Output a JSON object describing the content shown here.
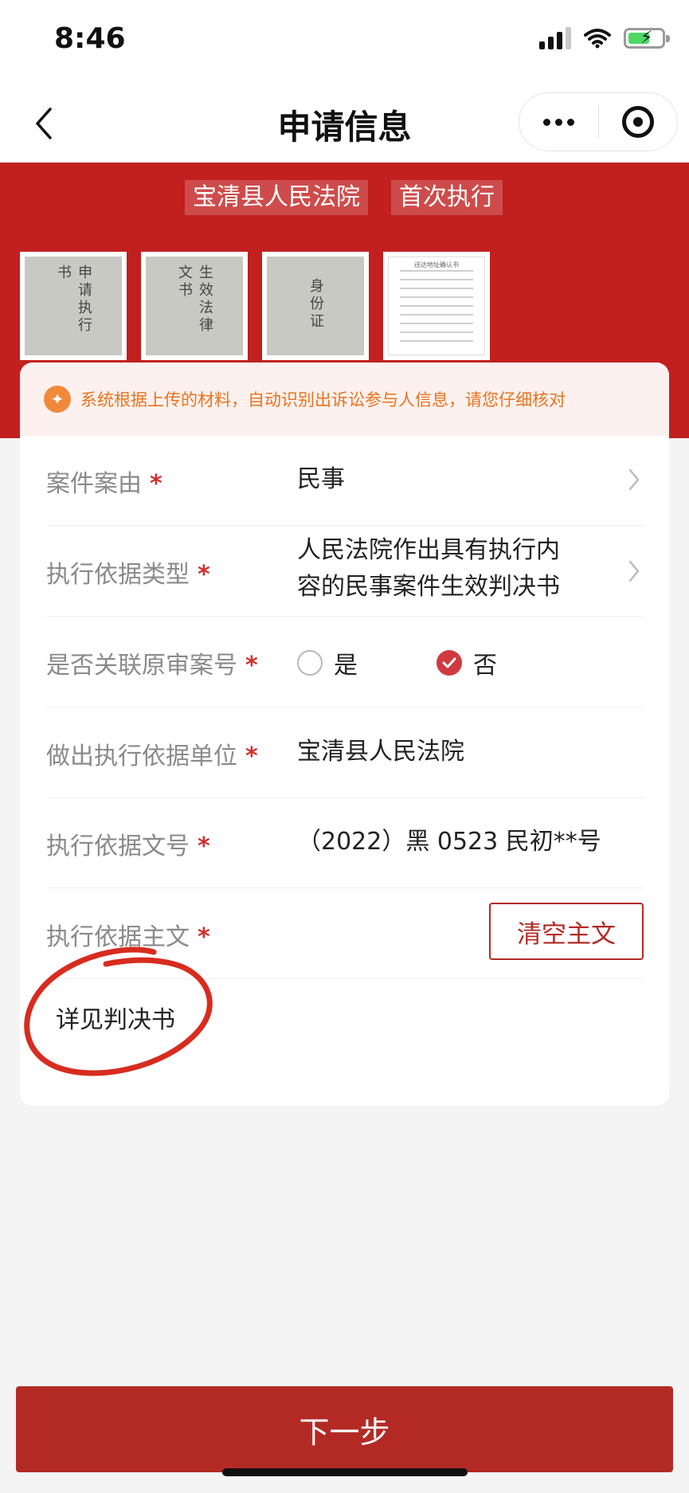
{
  "status_bar": {
    "time": "8:46"
  },
  "nav": {
    "title": "申请信息"
  },
  "hero": {
    "court_tag": "宝清县人民法院",
    "type_tag": "首次执行",
    "thumbnails": [
      {
        "text": "申请执行书"
      },
      {
        "text": "生效法律文书"
      },
      {
        "text": "身份证"
      },
      {
        "text": "送达地址确认书"
      }
    ]
  },
  "notice": {
    "text": "系统根据上传的材料，自动识别出诉讼参与人信息，请您仔细核对"
  },
  "form": {
    "cause": {
      "label": "案件案由",
      "value": "民事"
    },
    "basis_type": {
      "label": "执行依据类型",
      "value_line1": "人民法院作出具有执行内",
      "value_line2": "容的民事案件生效判决书"
    },
    "related": {
      "label": "是否关联原审案号",
      "option_yes": "是",
      "option_no": "否",
      "selected": "否"
    },
    "unit": {
      "label": "做出执行依据单位",
      "value": "宝清县人民法院"
    },
    "doc_no": {
      "label": "执行依据文号",
      "value": "（2022）黑 0523 民初**号"
    },
    "main_text": {
      "label": "执行依据主文",
      "clear_label": "清空主文",
      "value": "详见判决书"
    },
    "required_mark": "*"
  },
  "footer": {
    "next_label": "下一步"
  },
  "colors": {
    "brand_red": "#c1201f",
    "button_red": "#b32a25",
    "notice_orange": "#e8741d"
  }
}
